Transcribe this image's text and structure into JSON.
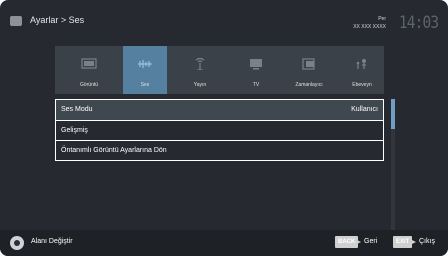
{
  "header": {
    "breadcrumb": "Ayarlar > Ses",
    "clock": {
      "day": "Per",
      "date": "XX XXX XXXX",
      "time": "14:03"
    }
  },
  "categories": [
    {
      "label": "Görüntü",
      "icon": "picture-icon",
      "active": false
    },
    {
      "label": "Ses",
      "icon": "sound-icon",
      "active": true
    },
    {
      "label": "Yayın",
      "icon": "broadcast-icon",
      "active": false
    },
    {
      "label": "TV",
      "icon": "tv-icon",
      "active": false
    },
    {
      "label": "Zamanlayıcı",
      "icon": "timer-icon",
      "active": false
    },
    {
      "label": "Ebeveyn",
      "icon": "parental-icon",
      "active": false
    }
  ],
  "menu": [
    {
      "label": "Ses Modu",
      "value": "Kullanıcı"
    },
    {
      "label": "Gelişmiş",
      "value": ""
    },
    {
      "label": "Öntanımlı Görüntü Ayarlarına Dön",
      "value": ""
    }
  ],
  "footer": {
    "nav_label": "Alanı Değiştir",
    "back_key": "BACK",
    "back_label": "Geri",
    "exit_key": "EXIT",
    "exit_label": "Çıkış"
  },
  "colors": {
    "background": "#262a30",
    "active_tab": "#55809f",
    "scroll_thumb": "#6e9ec4"
  }
}
